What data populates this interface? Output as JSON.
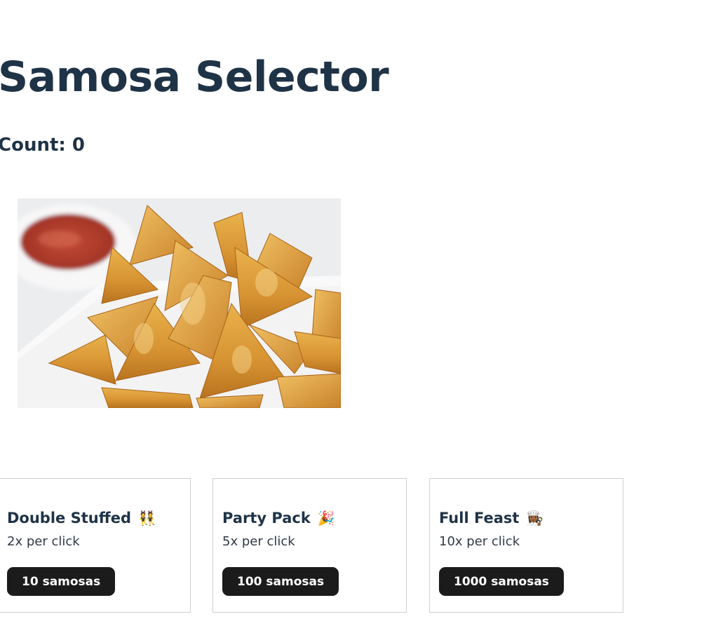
{
  "app": {
    "title": "Samosa Selector",
    "count_text": "Count: 0"
  },
  "samosa_image": {
    "alt": "Plate of fried samosas with ketchup"
  },
  "upgrades": [
    {
      "title": "Double Stuffed",
      "icon": "dancing-people-icon",
      "icon_glyph": "👯",
      "description": "2x per click",
      "button_label": "10 samosas"
    },
    {
      "title": "Party Pack",
      "icon": "party-popper-icon",
      "icon_glyph": "🎉",
      "description": "5x per click",
      "button_label": "100 samosas"
    },
    {
      "title": "Full Feast",
      "icon": "cook-icon",
      "icon_glyph": "👩🏾‍🍳",
      "description": "10x per click",
      "button_label": "1000 samosas"
    }
  ],
  "colors": {
    "heading": "#1f3347",
    "button_bg": "#1b1b1c",
    "button_text": "#ffffff",
    "card_border": "#cfcfd3"
  }
}
